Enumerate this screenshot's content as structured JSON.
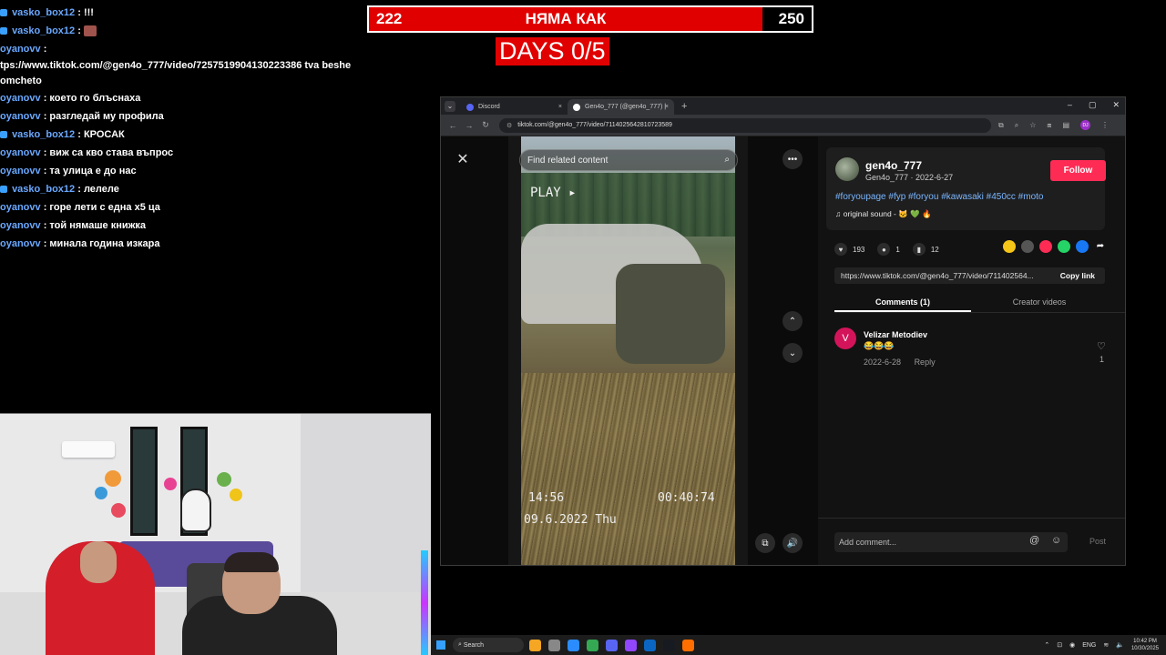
{
  "chat": [
    {
      "user": "vasko_box12",
      "sep": " : ",
      "text": "!!!",
      "badge": true,
      "emote": false
    },
    {
      "user": "vasko_box12",
      "sep": " : ",
      "text": "",
      "badge": true,
      "emote": true
    },
    {
      "user": "oyanovv",
      "sep": " : ",
      "text": "",
      "badge": false,
      "emote": false
    },
    {
      "user": "",
      "sep": "",
      "text": "tps://www.tiktok.com/@gen4o_777/video/7257519904130223386 tva beshe",
      "badge": false,
      "emote": false
    },
    {
      "user": "",
      "sep": "",
      "text": "omcheto",
      "badge": false,
      "emote": false
    },
    {
      "user": "oyanovv",
      "sep": " : ",
      "text": "което го блъснаха",
      "badge": false,
      "emote": false
    },
    {
      "user": "oyanovv",
      "sep": " : ",
      "text": "разгледай му профила",
      "badge": false,
      "emote": false
    },
    {
      "user": "vasko_box12",
      "sep": " : ",
      "text": "КРОСАК",
      "badge": true,
      "emote": false
    },
    {
      "user": "oyanovv",
      "sep": " : ",
      "text": "виж са кво става въпрос",
      "badge": false,
      "emote": false
    },
    {
      "user": "oyanovv",
      "sep": " : ",
      "text": "та улица е до нас",
      "badge": false,
      "emote": false
    },
    {
      "user": "vasko_box12",
      "sep": " : ",
      "text": "лелеле",
      "badge": true,
      "emote": false
    },
    {
      "user": "oyanovv",
      "sep": " : ",
      "text": "горе лети с една х5 ца",
      "badge": false,
      "emote": false
    },
    {
      "user": "oyanovv",
      "sep": " : ",
      "text": "той нямаше книжка",
      "badge": false,
      "emote": false
    },
    {
      "user": "oyanovv",
      "sep": " : ",
      "text": "минала година изкара",
      "badge": false,
      "emote": false
    }
  ],
  "score": {
    "left": "222",
    "title": "НЯМА КАК",
    "right": "250",
    "progress_fraction": 0.888
  },
  "days": "DAYS  0/5",
  "browser": {
    "tabs": [
      {
        "label": "Discord",
        "color": "#5865f2",
        "active": false
      },
      {
        "label": "Gen4o_777 (@gen4o_777) |",
        "color": "#ffffff",
        "active": true
      }
    ],
    "tab_close": "×",
    "tab_add": "+",
    "window_controls": [
      "–",
      "▢",
      "✕"
    ],
    "url": "tiktok.com/@gen4o_777/video/7114025642810723589",
    "nav": [
      "←",
      "→",
      "↻"
    ],
    "profile_initials": "DJ"
  },
  "tiktok": {
    "close_icon": "✕",
    "search_placeholder": "Find related content",
    "video_overlay": {
      "play": "PLAY ▸",
      "time": "14:56",
      "counter": "00:40:74",
      "date": "09.6.2022 Thu"
    },
    "more_icon": "•••",
    "up_icon": "⌃",
    "down_icon": "⌄",
    "author": {
      "name": "gen4o_777",
      "sub": "Gen4o_777 · 2022-6-27",
      "follow": "Follow"
    },
    "hashtags": "#foryoupage #fyp #foryou #kawasaki #450cc #moto",
    "sound": "original sound - 🐱 💚 🔥",
    "stats": {
      "likes": "193",
      "comments": "1",
      "saves": "12"
    },
    "share_colors": [
      "#f5c518",
      "#555555",
      "#fe2c55",
      "#25d366",
      "#1877f2"
    ],
    "link": "https://www.tiktok.com/@gen4o_777/video/711402564...",
    "copy_link": "Copy link",
    "tabs": [
      "Comments (1)",
      "Creator videos"
    ],
    "comment": {
      "avatar": "V",
      "name": "Velizar Metodiev",
      "text": "😂😂😂",
      "date": "2022-6-28",
      "reply": "Reply",
      "likes": "1"
    },
    "add_comment": "Add comment...",
    "post": "Post"
  },
  "taskbar": {
    "search": "Search",
    "icon_colors": [
      "#f5a623",
      "#888888",
      "#2a8cff",
      "#34a853",
      "#5865f2",
      "#9146ff",
      "#0a66c2",
      "#171a21",
      "#ff6f00"
    ],
    "tray": {
      "lang": "ENG",
      "time": "10:42 PM",
      "date": "10/30/2025"
    }
  }
}
